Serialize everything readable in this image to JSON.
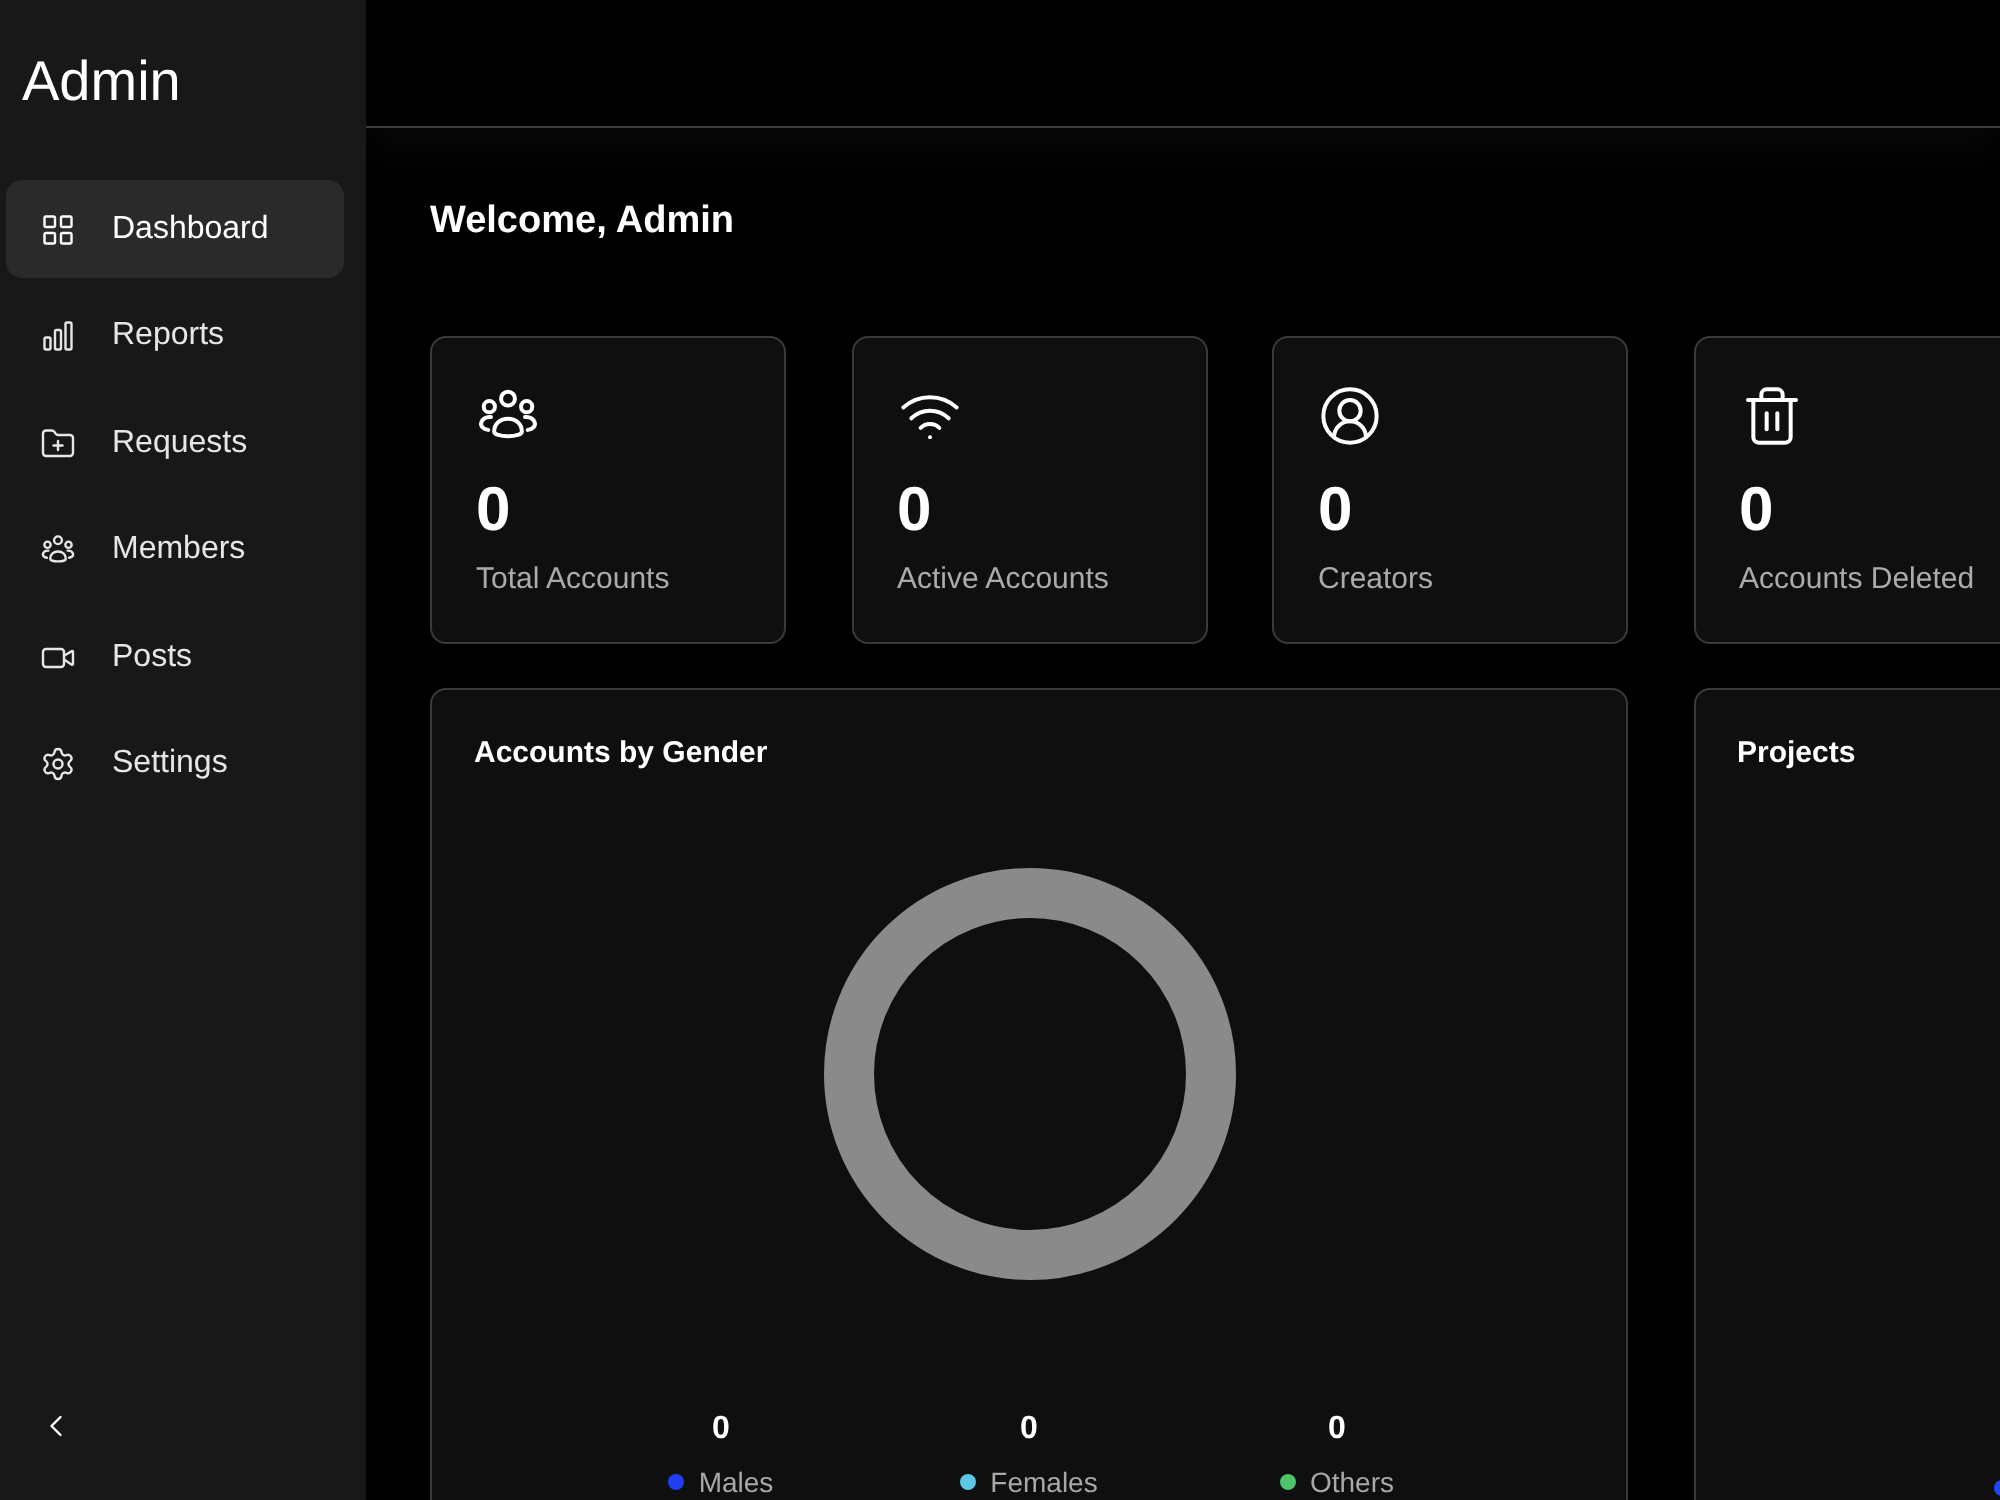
{
  "sidebar": {
    "title": "Admin",
    "items": [
      {
        "label": "Dashboard",
        "selected": true
      },
      {
        "label": "Reports",
        "selected": false
      },
      {
        "label": "Requests",
        "selected": false
      },
      {
        "label": "Members",
        "selected": false
      },
      {
        "label": "Posts",
        "selected": false
      },
      {
        "label": "Settings",
        "selected": false
      }
    ]
  },
  "header": {
    "welcome": "Welcome, Admin"
  },
  "stats": [
    {
      "value": "0",
      "label": "Total Accounts"
    },
    {
      "value": "0",
      "label": "Active Accounts"
    },
    {
      "value": "0",
      "label": "Creators"
    },
    {
      "value": "0",
      "label": "Accounts Deleted"
    }
  ],
  "gender_card": {
    "title": "Accounts by Gender",
    "legend": [
      {
        "value": "0",
        "label": "Males",
        "color": "#1f3ff2"
      },
      {
        "value": "0",
        "label": "Females",
        "color": "#5cc8e6"
      },
      {
        "value": "0",
        "label": "Others",
        "color": "#4cc46a"
      }
    ]
  },
  "projects_card": {
    "title": "Projects",
    "legend": [
      {
        "color": "#2146f3"
      }
    ]
  }
}
